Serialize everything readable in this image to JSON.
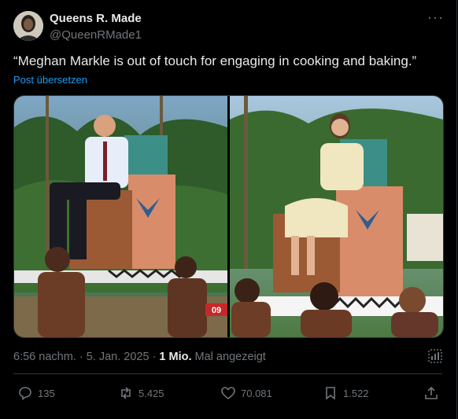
{
  "author": {
    "name": "Queens R. Made",
    "handle": "@QueenRMade1"
  },
  "tweet": {
    "text": "“Meghan Markle is out of touch for engaging in cooking and baking.”",
    "translate_label": "Post übersetzen"
  },
  "meta": {
    "time": "6:56 nachm.",
    "separator": " · ",
    "date": "5. Jan. 2025",
    "views_separator": " · ",
    "views": "1 Mio.",
    "views_label": " Mal angezeigt"
  },
  "media": {
    "left_badge": "09"
  },
  "actions": {
    "replies": "135",
    "reposts": "5.425",
    "likes": "70.081",
    "bookmarks": "1.522"
  },
  "icons": [
    "more-icon",
    "analytics-icon",
    "reply-icon",
    "repost-icon",
    "like-icon",
    "bookmark-icon",
    "share-icon"
  ],
  "colors": {
    "accent": "#1d9bf0",
    "muted": "#71767b",
    "text": "#e7e9ea",
    "background": "#000000"
  }
}
